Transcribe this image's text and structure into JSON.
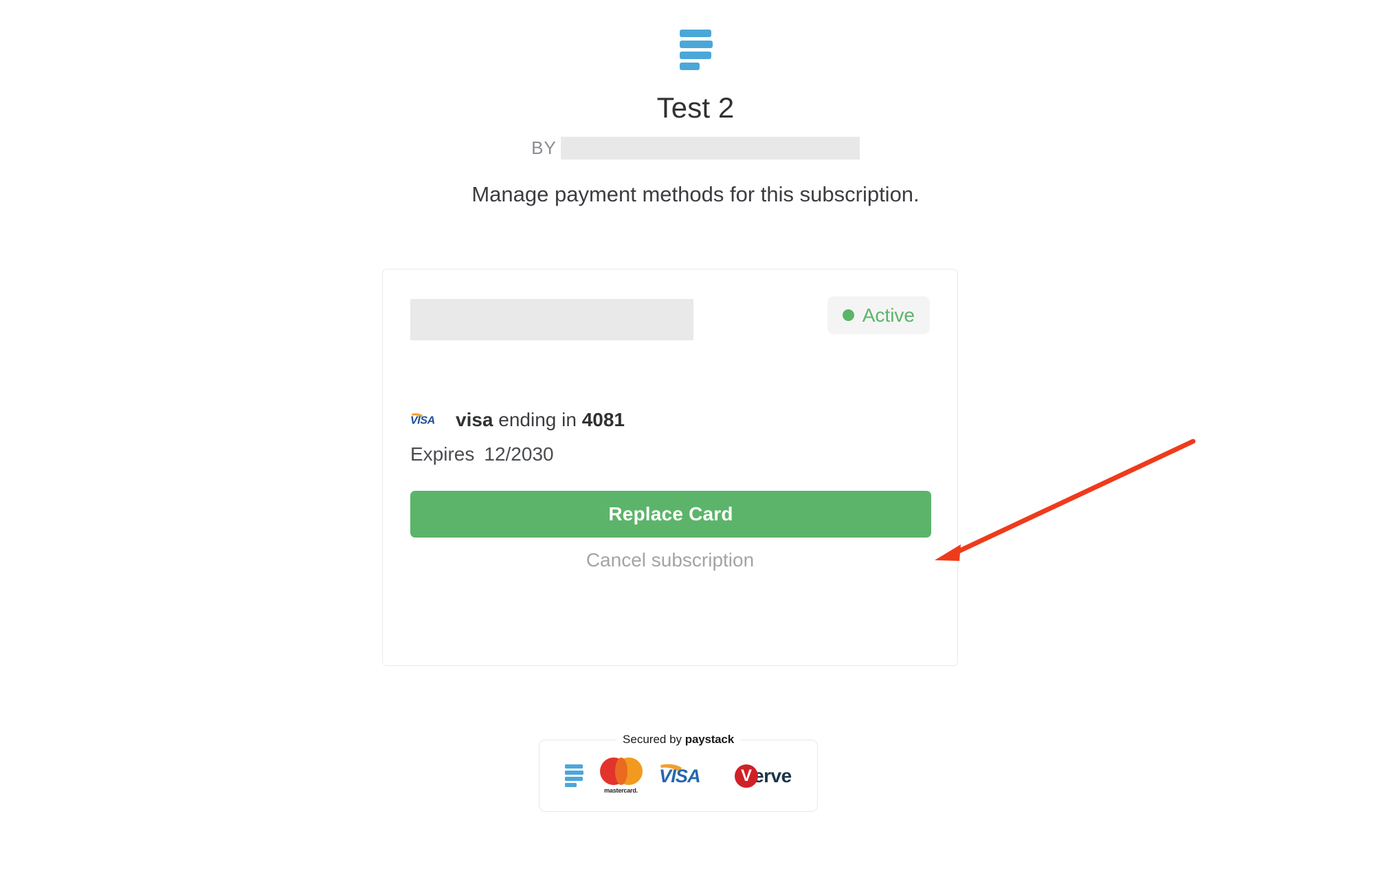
{
  "brand": {
    "logo_icon": "paystack-bars-icon",
    "logo_color": "#4ba7d8"
  },
  "header": {
    "title": "Test 2",
    "by_label": "BY",
    "by_value_redacted": true,
    "subtitle": "Manage payment methods for this subscription."
  },
  "subscription_card": {
    "plan_name_redacted": true,
    "status": {
      "label": "Active",
      "dot_icon": "status-dot-icon",
      "color": "#5cb46a",
      "background": "#f4f4f4"
    },
    "payment_method": {
      "brand_icon": "visa-icon",
      "brand_label": "visa",
      "ending_text": "ending in",
      "last4": "4081",
      "expiry_label": "Expires",
      "expiry_value": "12/2030"
    },
    "primary_action": {
      "label": "Replace Card",
      "color": "#5cb46a"
    },
    "secondary_action": {
      "label": "Cancel subscription"
    }
  },
  "footer": {
    "secured_prefix": "Secured by",
    "secured_brand": "paystack",
    "accepted_methods": [
      {
        "name": "paystack-icon",
        "label": "paystack"
      },
      {
        "name": "mastercard-icon",
        "label": "mastercard."
      },
      {
        "name": "visa-icon",
        "label": "VISA"
      },
      {
        "name": "verve-icon",
        "label": "Verve",
        "initial": "V",
        "rest": "erve"
      }
    ]
  },
  "annotation": {
    "type": "arrow",
    "color": "#ee3b1c",
    "points_to": "Replace Card"
  }
}
